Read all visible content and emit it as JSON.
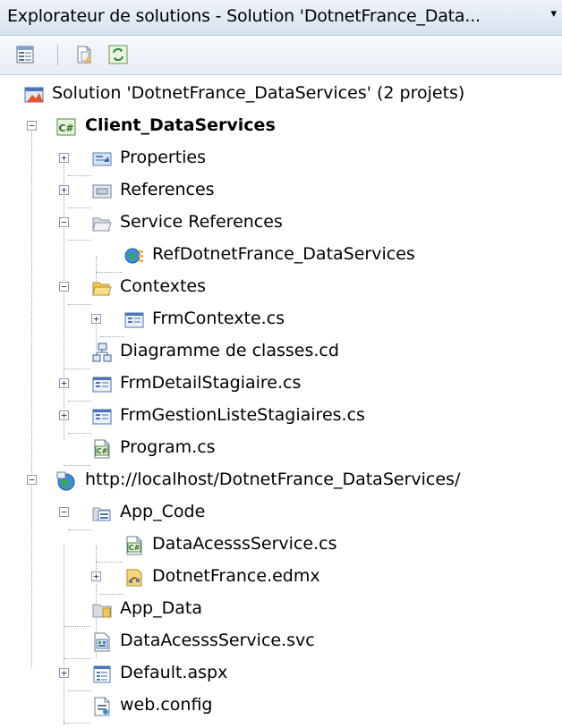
{
  "window": {
    "title": "Explorateur de solutions - Solution 'DotnetFrance_Data...",
    "dropdown_glyph": "▾"
  },
  "toolbar": {
    "buttons": [
      {
        "icon": "properties-icon"
      },
      {
        "icon": "show-all-files-icon"
      },
      {
        "icon": "refresh-icon"
      }
    ]
  },
  "tree": {
    "solution": "Solution 'DotnetFrance_DataServices' (2 projets)",
    "client_project": "Client_DataServices",
    "properties": "Properties",
    "references": "References",
    "service_references": "Service References",
    "ref_dotnet": "RefDotnetFrance_DataServices",
    "contextes": "Contextes",
    "frm_contexte": "FrmContexte.cs",
    "diagramme": "Diagramme de classes.cd",
    "frm_detail": "FrmDetailStagiaire.cs",
    "frm_gestion": "FrmGestionListeStagiaires.cs",
    "program": "Program.cs",
    "web_project": "http://localhost/DotnetFrance_DataServices/",
    "app_code": "App_Code",
    "data_access_cs": "DataAcesssService.cs",
    "edmx": "DotnetFrance.edmx",
    "app_data": "App_Data",
    "data_access_svc": "DataAcesssService.svc",
    "default_aspx": "Default.aspx",
    "web_config": "web.config"
  }
}
